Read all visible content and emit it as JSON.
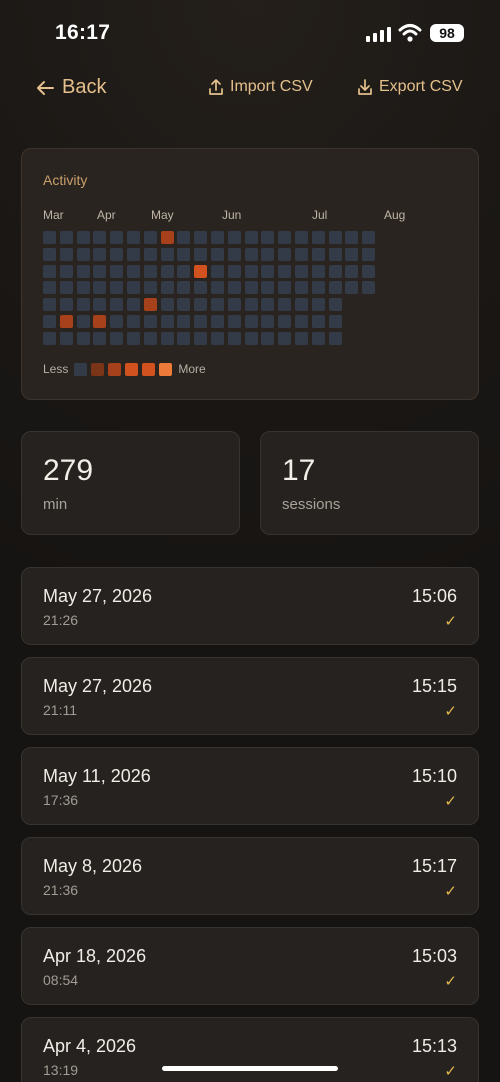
{
  "status_bar": {
    "time": "16:17",
    "battery": "98"
  },
  "nav": {
    "back_label": "Back",
    "import_label": "Import CSV",
    "export_label": "Export CSV"
  },
  "activity": {
    "title": "Activity",
    "months": [
      "Mar",
      "Apr",
      "May",
      "Jun",
      "Jul",
      "Aug"
    ],
    "legend_less": "Less",
    "legend_more": "More",
    "legend_colors": [
      "#343b48",
      "#5a2f1c",
      "#7a3519",
      "#a7411b",
      "#d2521f",
      "#ee7a3a"
    ],
    "weeks": 20,
    "highlights": [
      {
        "week": 7,
        "day": 0,
        "level": 3
      },
      {
        "week": 9,
        "day": 2,
        "level": 4
      },
      {
        "week": 6,
        "day": 4,
        "level": 3
      },
      {
        "week": 1,
        "day": 5,
        "level": 3
      },
      {
        "week": 3,
        "day": 5,
        "level": 3
      }
    ]
  },
  "stats": {
    "minutes_value": "279",
    "minutes_label": "min",
    "sessions_value": "17",
    "sessions_label": "sessions"
  },
  "sessions": [
    {
      "date": "May 27, 2026",
      "time": "21:26",
      "duration": "15:06",
      "check": "✓"
    },
    {
      "date": "May 27, 2026",
      "time": "21:11",
      "duration": "15:15",
      "check": "✓"
    },
    {
      "date": "May 11, 2026",
      "time": "17:36",
      "duration": "15:10",
      "check": "✓"
    },
    {
      "date": "May 8, 2026",
      "time": "21:36",
      "duration": "15:17",
      "check": "✓"
    },
    {
      "date": "Apr 18, 2026",
      "time": "08:54",
      "duration": "15:03",
      "check": "✓"
    },
    {
      "date": "Apr 4, 2026",
      "time": "13:19",
      "duration": "15:13",
      "check": "✓"
    }
  ]
}
